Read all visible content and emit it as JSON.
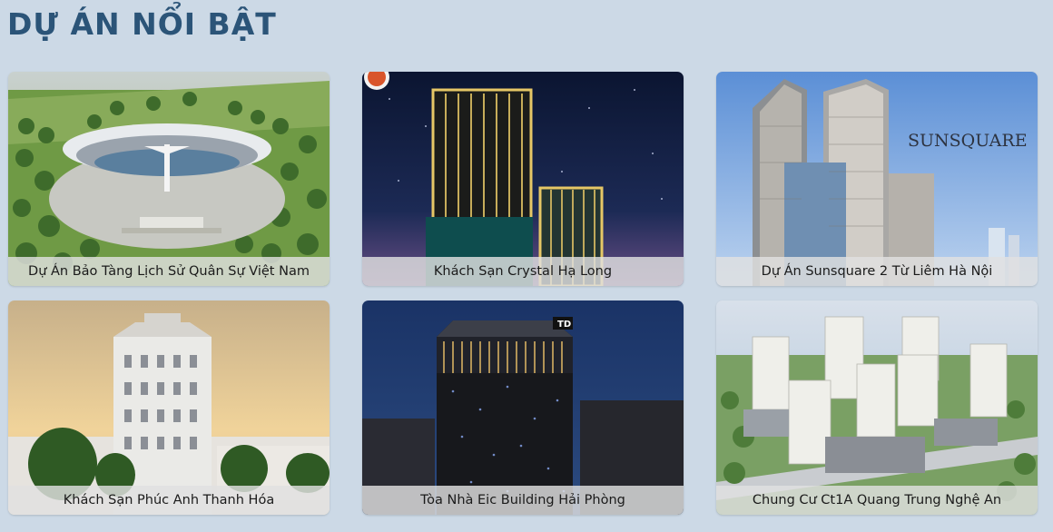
{
  "section": {
    "title": "DỰ ÁN NỔI BẬT"
  },
  "projects": [
    {
      "name": "Dự Án Bảo Tàng Lịch Sử Quân Sự Việt Nam",
      "image": "military-museum-aerial-photo"
    },
    {
      "name": "Khách Sạn Crystal Hạ Long",
      "image": "crystal-hotel-night-photo",
      "badge_icon": "logo-badge-icon"
    },
    {
      "name": "Dự Án Sunsquare 2 Từ Liêm Hà Nội",
      "image": "sunsquare-towers-photo",
      "brand_text": "SUNSQUARE"
    },
    {
      "name": "Khách Sạn Phúc Anh Thanh Hóa",
      "image": "phuc-anh-hotel-photo"
    },
    {
      "name": "Tòa Nhà Eic Building Hải Phòng",
      "image": "eic-building-night-photo",
      "sign_text": "TD"
    },
    {
      "name": "Chung Cư Ct1A Quang Trung Nghệ An",
      "image": "apartment-complex-aerial-photo"
    }
  ],
  "colors": {
    "background": "#ccd9e6",
    "title": "#2b5478",
    "caption_bg": "#e1e1e1"
  }
}
